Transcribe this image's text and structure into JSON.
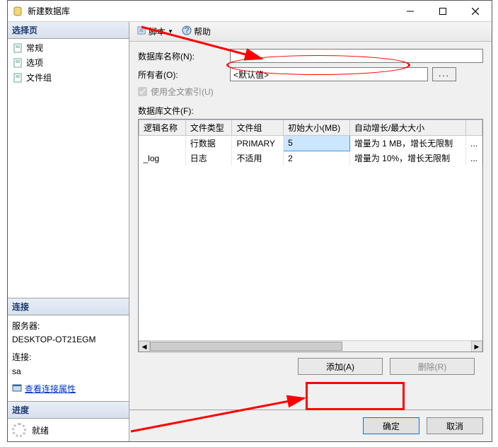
{
  "titlebar": {
    "title": "新建数据库"
  },
  "left": {
    "select_header": "选择页",
    "items": [
      {
        "label": "常规"
      },
      {
        "label": "选项"
      },
      {
        "label": "文件组"
      }
    ],
    "conn_header": "连接",
    "server_label": "服务器:",
    "server_value": "DESKTOP-OT21EGM",
    "conn_label": "连接:",
    "conn_value": "sa",
    "view_props": "查看连接属性",
    "progress_header": "进度",
    "progress_status": "就绪"
  },
  "toolbar": {
    "script": "脚本",
    "help": "帮助"
  },
  "form": {
    "db_name_label": "数据库名称(N):",
    "db_name_value": "",
    "owner_label": "所有者(O):",
    "owner_value": "<默认值>",
    "fulltext_label": "使用全文索引(U)",
    "data_files_label": "数据库文件(F):"
  },
  "grid": {
    "headers": [
      "逻辑名称",
      "文件类型",
      "文件组",
      "初始大小(MB)",
      "自动增长/最大大小"
    ],
    "rows": [
      {
        "name": "",
        "type": "行数据",
        "group": "PRIMARY",
        "size": "5",
        "growth": "增量为 1 MB，增长无限制"
      },
      {
        "name": "_log",
        "type": "日志",
        "group": "不适用",
        "size": "2",
        "growth": "增量为 10%，增长无限制"
      }
    ]
  },
  "buttons": {
    "add": "添加(A)",
    "remove": "删除(R)",
    "ok": "确定",
    "cancel": "取消"
  }
}
